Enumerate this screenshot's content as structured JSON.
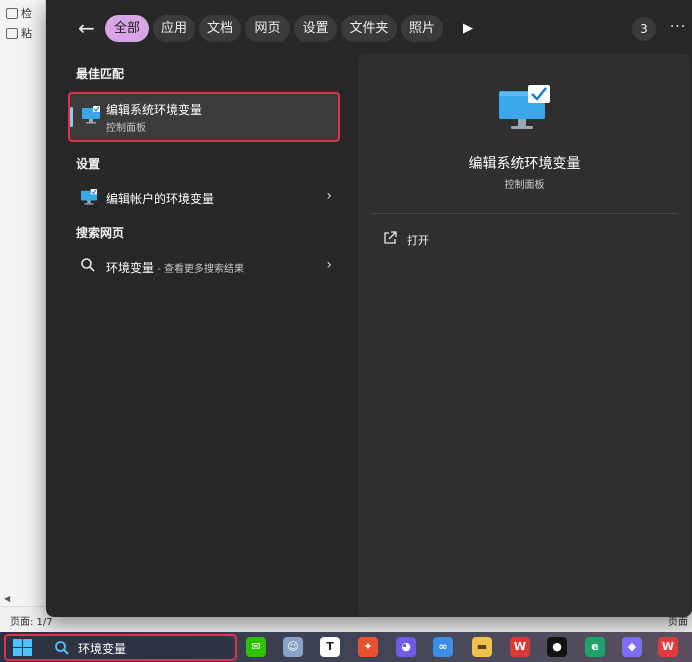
{
  "background_doc": {
    "items": [
      "检",
      "粘"
    ],
    "status_page": "页面: 1/7",
    "status_right": "页面"
  },
  "filters": {
    "back": "←",
    "chips": [
      "全部",
      "应用",
      "文档",
      "网页",
      "设置",
      "文件夹",
      "照片"
    ],
    "active_chip": "全部",
    "count": "3",
    "more": "···"
  },
  "results": {
    "best_match_heading": "最佳匹配",
    "best_match": {
      "title": "编辑系统环境变量",
      "subtitle": "控制面板"
    },
    "settings_heading": "设置",
    "settings_item": "编辑帐户的环境变量",
    "web_heading": "搜索网页",
    "web_item_query": "环境变量",
    "web_item_suffix": " - 查看更多搜索结果"
  },
  "detail": {
    "title": "编辑系统环境变量",
    "subtitle": "控制面板",
    "open_label": "打开"
  },
  "taskbar": {
    "search_text": "环境变量",
    "apps": [
      "wechat",
      "avatar-app",
      "typora",
      "sketch-app",
      "cat-app",
      "baidu-netdisk",
      "file-explorer",
      "wps",
      "qq",
      "edge",
      "app",
      "wps-office"
    ]
  },
  "colors": {
    "accent_chip": "#d8a6e6",
    "highlight_border": "#e0304a",
    "panel_bg": "#272727",
    "detail_bg": "#2f2f2f"
  }
}
